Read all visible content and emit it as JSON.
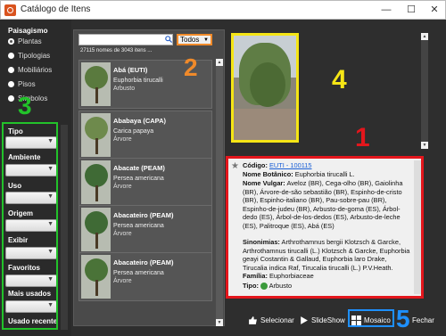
{
  "window": {
    "title": "Catálogo de Itens",
    "minimize": "—",
    "maximize": "☐",
    "close": "✕"
  },
  "sidebar": {
    "section_title": "Paisagismo",
    "radio_items": [
      {
        "label": "Plantas",
        "selected": true
      },
      {
        "label": "Tipologias",
        "selected": false
      },
      {
        "label": "Mobiliários",
        "selected": false
      },
      {
        "label": "Pisos",
        "selected": false
      },
      {
        "label": "Símbolos",
        "selected": false
      }
    ],
    "filters": [
      {
        "label": "Tipo"
      },
      {
        "label": "Ambiente"
      },
      {
        "label": "Uso"
      },
      {
        "label": "Origem"
      },
      {
        "label": "Exibir"
      },
      {
        "label": "Favoritos"
      },
      {
        "label": "Mais usados"
      },
      {
        "label": "Usado recente"
      }
    ]
  },
  "list": {
    "search_placeholder": "",
    "filter_value": "Todos",
    "count_text": "27115 nomes de 3043 itens ...",
    "items": [
      {
        "name": "Abá (EUTI)",
        "scientific": "Euphorbia tirucalli",
        "type": "Arbusto"
      },
      {
        "name": "Ababaya (CAPA)",
        "scientific": "Carica papaya",
        "type": "Árvore"
      },
      {
        "name": "Abacate (PEAM)",
        "scientific": "Persea americana",
        "type": "Árvore"
      },
      {
        "name": "Abacateiro (PEAM)",
        "scientific": "Persea americana",
        "type": "Árvore"
      },
      {
        "name": "Abacateiro (PEAM)",
        "scientific": "Persea americana",
        "type": "Árvore"
      }
    ]
  },
  "detail": {
    "code_label": "Código:",
    "code_value": "EUTI - 100115",
    "botanical_label": "Nome Botânico:",
    "botanical_value": "Euphorbia tirucalli L.",
    "vulgar_label": "Nome Vulgar:",
    "vulgar_value": "Aveloz (BR), Cega-olho (BR), Gaiolinha (BR), Árvore-de-são sebastião (BR), Espinho-de-cristo (BR), Espinho-italiano (BR), Pau-sobre-pau (BR), Espinho-de-judeu (BR), Arbusto-de-goma (ES), Árbol-dedo (ES), Árbol-de-los-dedos (ES), Arbusto-de-leche (ES), Palitroque (ES), Abá (ES)",
    "syn_label": "Sinonimias:",
    "syn_value": "Arthrothamnus bergii Klotzsch & Garcke, Arthrothamnus tirucalli (L.) Klotzsch & Garcke, Euphorbia geayi Costantin & Gallaud, Euphorbia laro Drake, Tirucalia indica Raf, Tirucalia tirucalli (L.) P.V.Heath.",
    "family_label": "Família:",
    "family_value": "Euphorbiaceae",
    "type_label": "Tipo:",
    "type_value": "Arbusto"
  },
  "toolbar": {
    "select_label": "Selecionar",
    "slideshow_label": "SlideShow",
    "mosaic_label": "Mosaico",
    "close_label": "Fechar"
  },
  "annotations": {
    "n1": "1",
    "n2": "2",
    "n3": "3",
    "n4": "4",
    "n5": "5",
    "c1": "#e3161c",
    "c2": "#f08a2a",
    "c3": "#22c22a",
    "c4": "#f5e515",
    "c5": "#1e90ff"
  }
}
